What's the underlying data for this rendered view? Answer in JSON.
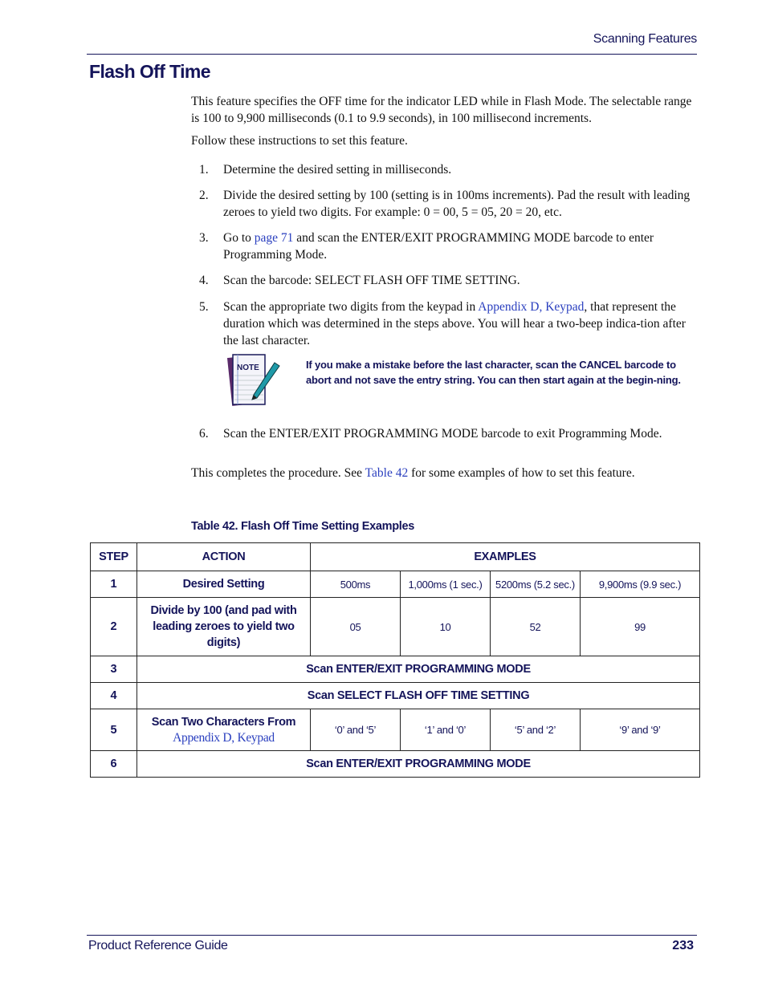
{
  "header": {
    "running_head": "Scanning Features",
    "title": "Flash Off Time"
  },
  "body": {
    "intro": "This feature specifies the OFF time for the indicator LED while in Flash Mode. The selectable range is 100 to 9,900 milliseconds (0.1 to 9.9 seconds), in 100 millisecond increments.",
    "follow": "Follow these instructions to set this feature.",
    "steps": [
      {
        "num": "1.",
        "text": "Determine the desired setting in milliseconds."
      },
      {
        "num": "2.",
        "text": "Divide the desired setting by 100 (setting is in 100ms increments). Pad the result with leading zeroes to yield two digits. For example: 0 = 00, 5 = 05, 20 = 20, etc."
      },
      {
        "num": "3.",
        "pre": "Go to ",
        "link": "page 71",
        "post": " and scan the ENTER/EXIT PROGRAMMING MODE barcode to enter Programming Mode."
      },
      {
        "num": "4.",
        "text": "Scan the barcode: SELECT FLASH OFF TIME SETTING."
      },
      {
        "num": "5.",
        "pre": "Scan the appropriate two digits from the keypad in ",
        "link": "Appendix D, Keypad",
        "post": ", that represent the duration which was determined in the steps above. You will hear a two-beep indica-tion after the last character."
      },
      {
        "num": "6.",
        "text": "Scan the ENTER/EXIT PROGRAMMING MODE barcode to exit Programming Mode."
      }
    ],
    "note": {
      "icon_label": "NOTE",
      "text": "If you make a mistake before the last character, scan the CANCEL barcode to abort and not save the entry string. You can then start again at the begin-ning."
    },
    "completion": {
      "pre": "This completes the procedure. See ",
      "link": "Table 42",
      "post": " for some examples of how to set this feature."
    }
  },
  "table": {
    "caption": "Table 42. Flash Off Time Setting Examples",
    "headers": [
      "STEP",
      "ACTION",
      "EXAMPLES"
    ],
    "rows": [
      {
        "step": "1",
        "action": "Desired Setting",
        "values": [
          "500ms",
          "1,000ms (1 sec.)",
          "5200ms (5.2 sec.)",
          "9,900ms (9.9 sec.)"
        ]
      },
      {
        "step": "2",
        "action": "Divide by 100 (and pad with leading zeroes to yield two digits)",
        "values": [
          "05",
          "10",
          "52",
          "99"
        ]
      },
      {
        "step": "3",
        "span": "Scan ENTER/EXIT PROGRAMMING MODE"
      },
      {
        "step": "4",
        "span": "Scan SELECT FLASH OFF TIME SETTING"
      },
      {
        "step": "5",
        "action": "Scan Two Characters From",
        "action_link": "Appendix D, Keypad",
        "values": [
          "‘0’ and ‘5’",
          "‘1’ and ‘0’",
          "‘5’ and ‘2’",
          "‘9’ and ‘9’"
        ]
      },
      {
        "step": "6",
        "span": "Scan ENTER/EXIT PROGRAMMING MODE"
      }
    ]
  },
  "footer": {
    "left": "Product Reference Guide",
    "page_number": "233"
  }
}
